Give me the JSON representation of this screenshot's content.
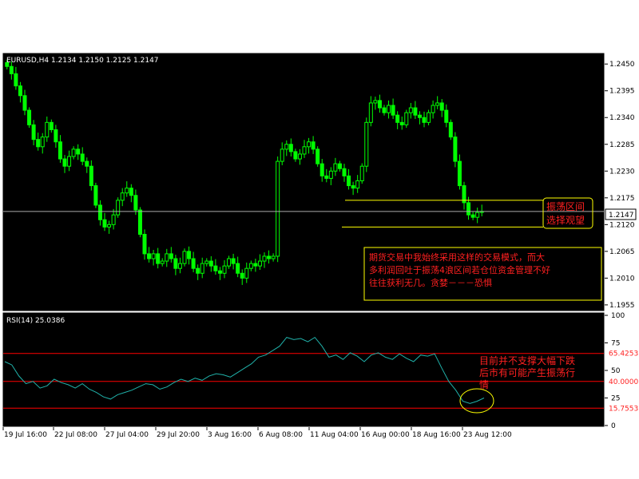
{
  "chart_data": [
    {
      "type": "candlestick",
      "title": "EURUSD,H4  1.2134 1.2150 1.2125 1.2147",
      "ylim": [
        1.1945,
        1.247
      ],
      "y_ticks": [
        "1.2450",
        "1.2395",
        "1.2340",
        "1.2285",
        "1.2230",
        "1.2175",
        "1.2120",
        "1.2065",
        "1.2010",
        "1.1955"
      ],
      "current_price": "1.2147",
      "grid": false,
      "colors": {
        "bull": "#00ff00",
        "bear": "#00ff00",
        "background": "#000000",
        "axis": "#ffffff",
        "price_line": "#aaaaaa"
      },
      "series_close": [
        1.2445,
        1.243,
        1.2405,
        1.2385,
        1.2355,
        1.2325,
        1.2295,
        1.228,
        1.23,
        1.233,
        1.2315,
        1.229,
        1.2255,
        1.224,
        1.226,
        1.2275,
        1.2265,
        1.225,
        1.224,
        1.22,
        1.216,
        1.213,
        1.2115,
        1.212,
        1.214,
        1.217,
        1.2185,
        1.2195,
        1.218,
        1.215,
        1.21,
        1.206,
        1.205,
        1.206,
        1.204,
        1.2045,
        1.206,
        1.205,
        1.203,
        1.204,
        1.2065,
        1.205,
        1.203,
        1.202,
        1.204,
        1.2045,
        1.2035,
        1.2025,
        1.202,
        1.2035,
        1.205,
        1.204,
        1.202,
        1.201,
        1.203,
        1.204,
        1.2035,
        1.2045,
        1.2055,
        1.205,
        1.2055,
        1.225,
        1.2275,
        1.2285,
        1.227,
        1.2255,
        1.2265,
        1.228,
        1.229,
        1.2275,
        1.2245,
        1.222,
        1.2215,
        1.223,
        1.2245,
        1.2235,
        1.222,
        1.22,
        1.2195,
        1.221,
        1.224,
        1.233,
        1.237,
        1.2375,
        1.236,
        1.235,
        1.2365,
        1.2345,
        1.233,
        1.2325,
        1.235,
        1.236,
        1.2345,
        1.234,
        1.233,
        1.235,
        1.2365,
        1.237,
        1.2355,
        1.233,
        1.23,
        1.225,
        1.22,
        1.2165,
        1.214,
        1.2135,
        1.2145,
        1.2147
      ],
      "annotations": {
        "box1": [
          "振荡区间",
          "选择观望"
        ],
        "box2": [
          "期货交易中我始终采用这样的交易模式，而大",
          "多利润回吐于振荡4浪区间若仓位资金管理不好",
          "往往获利无几。贪婪－－－恐惧"
        ],
        "hlines": [
          1.217,
          1.2115
        ]
      }
    },
    {
      "type": "line",
      "title": "RSI(14)  25.0386",
      "ylim": [
        0,
        100
      ],
      "y_ticks": [
        "100",
        "75",
        "50",
        "25",
        "0"
      ],
      "levels": [
        "65.4253",
        "40.0000",
        "15.7553"
      ],
      "level_values": [
        65.4253,
        40.0,
        15.7553
      ],
      "colors": {
        "line": "#20b2aa",
        "level": "#ff0000"
      },
      "series": [
        58,
        55,
        45,
        38,
        40,
        34,
        36,
        42,
        39,
        37,
        34,
        38,
        33,
        30,
        26,
        24,
        28,
        30,
        32,
        35,
        38,
        37,
        33,
        35,
        39,
        42,
        40,
        43,
        41,
        45,
        47,
        46,
        44,
        48,
        52,
        56,
        62,
        64,
        68,
        72,
        80,
        78,
        79,
        76,
        80,
        72,
        62,
        64,
        60,
        66,
        63,
        58,
        64,
        66,
        62,
        60,
        65,
        61,
        58,
        64,
        63,
        65,
        52,
        40,
        32,
        22,
        20,
        22,
        25
      ],
      "annotations": {
        "box": [
          "目前并不支撑大幅下跌",
          "后市有可能产生振荡行",
          "情"
        ]
      }
    }
  ],
  "x_ticks": [
    "19 Jul 16:00",
    "22 Jul 08:00",
    "27 Jul 04:00",
    "29 Jul 20:00",
    "3 Aug 16:00",
    "6 Aug 08:00",
    "11 Aug 04:00",
    "16 Aug 00:00",
    "18 Aug 16:00",
    "23 Aug 12:00"
  ]
}
